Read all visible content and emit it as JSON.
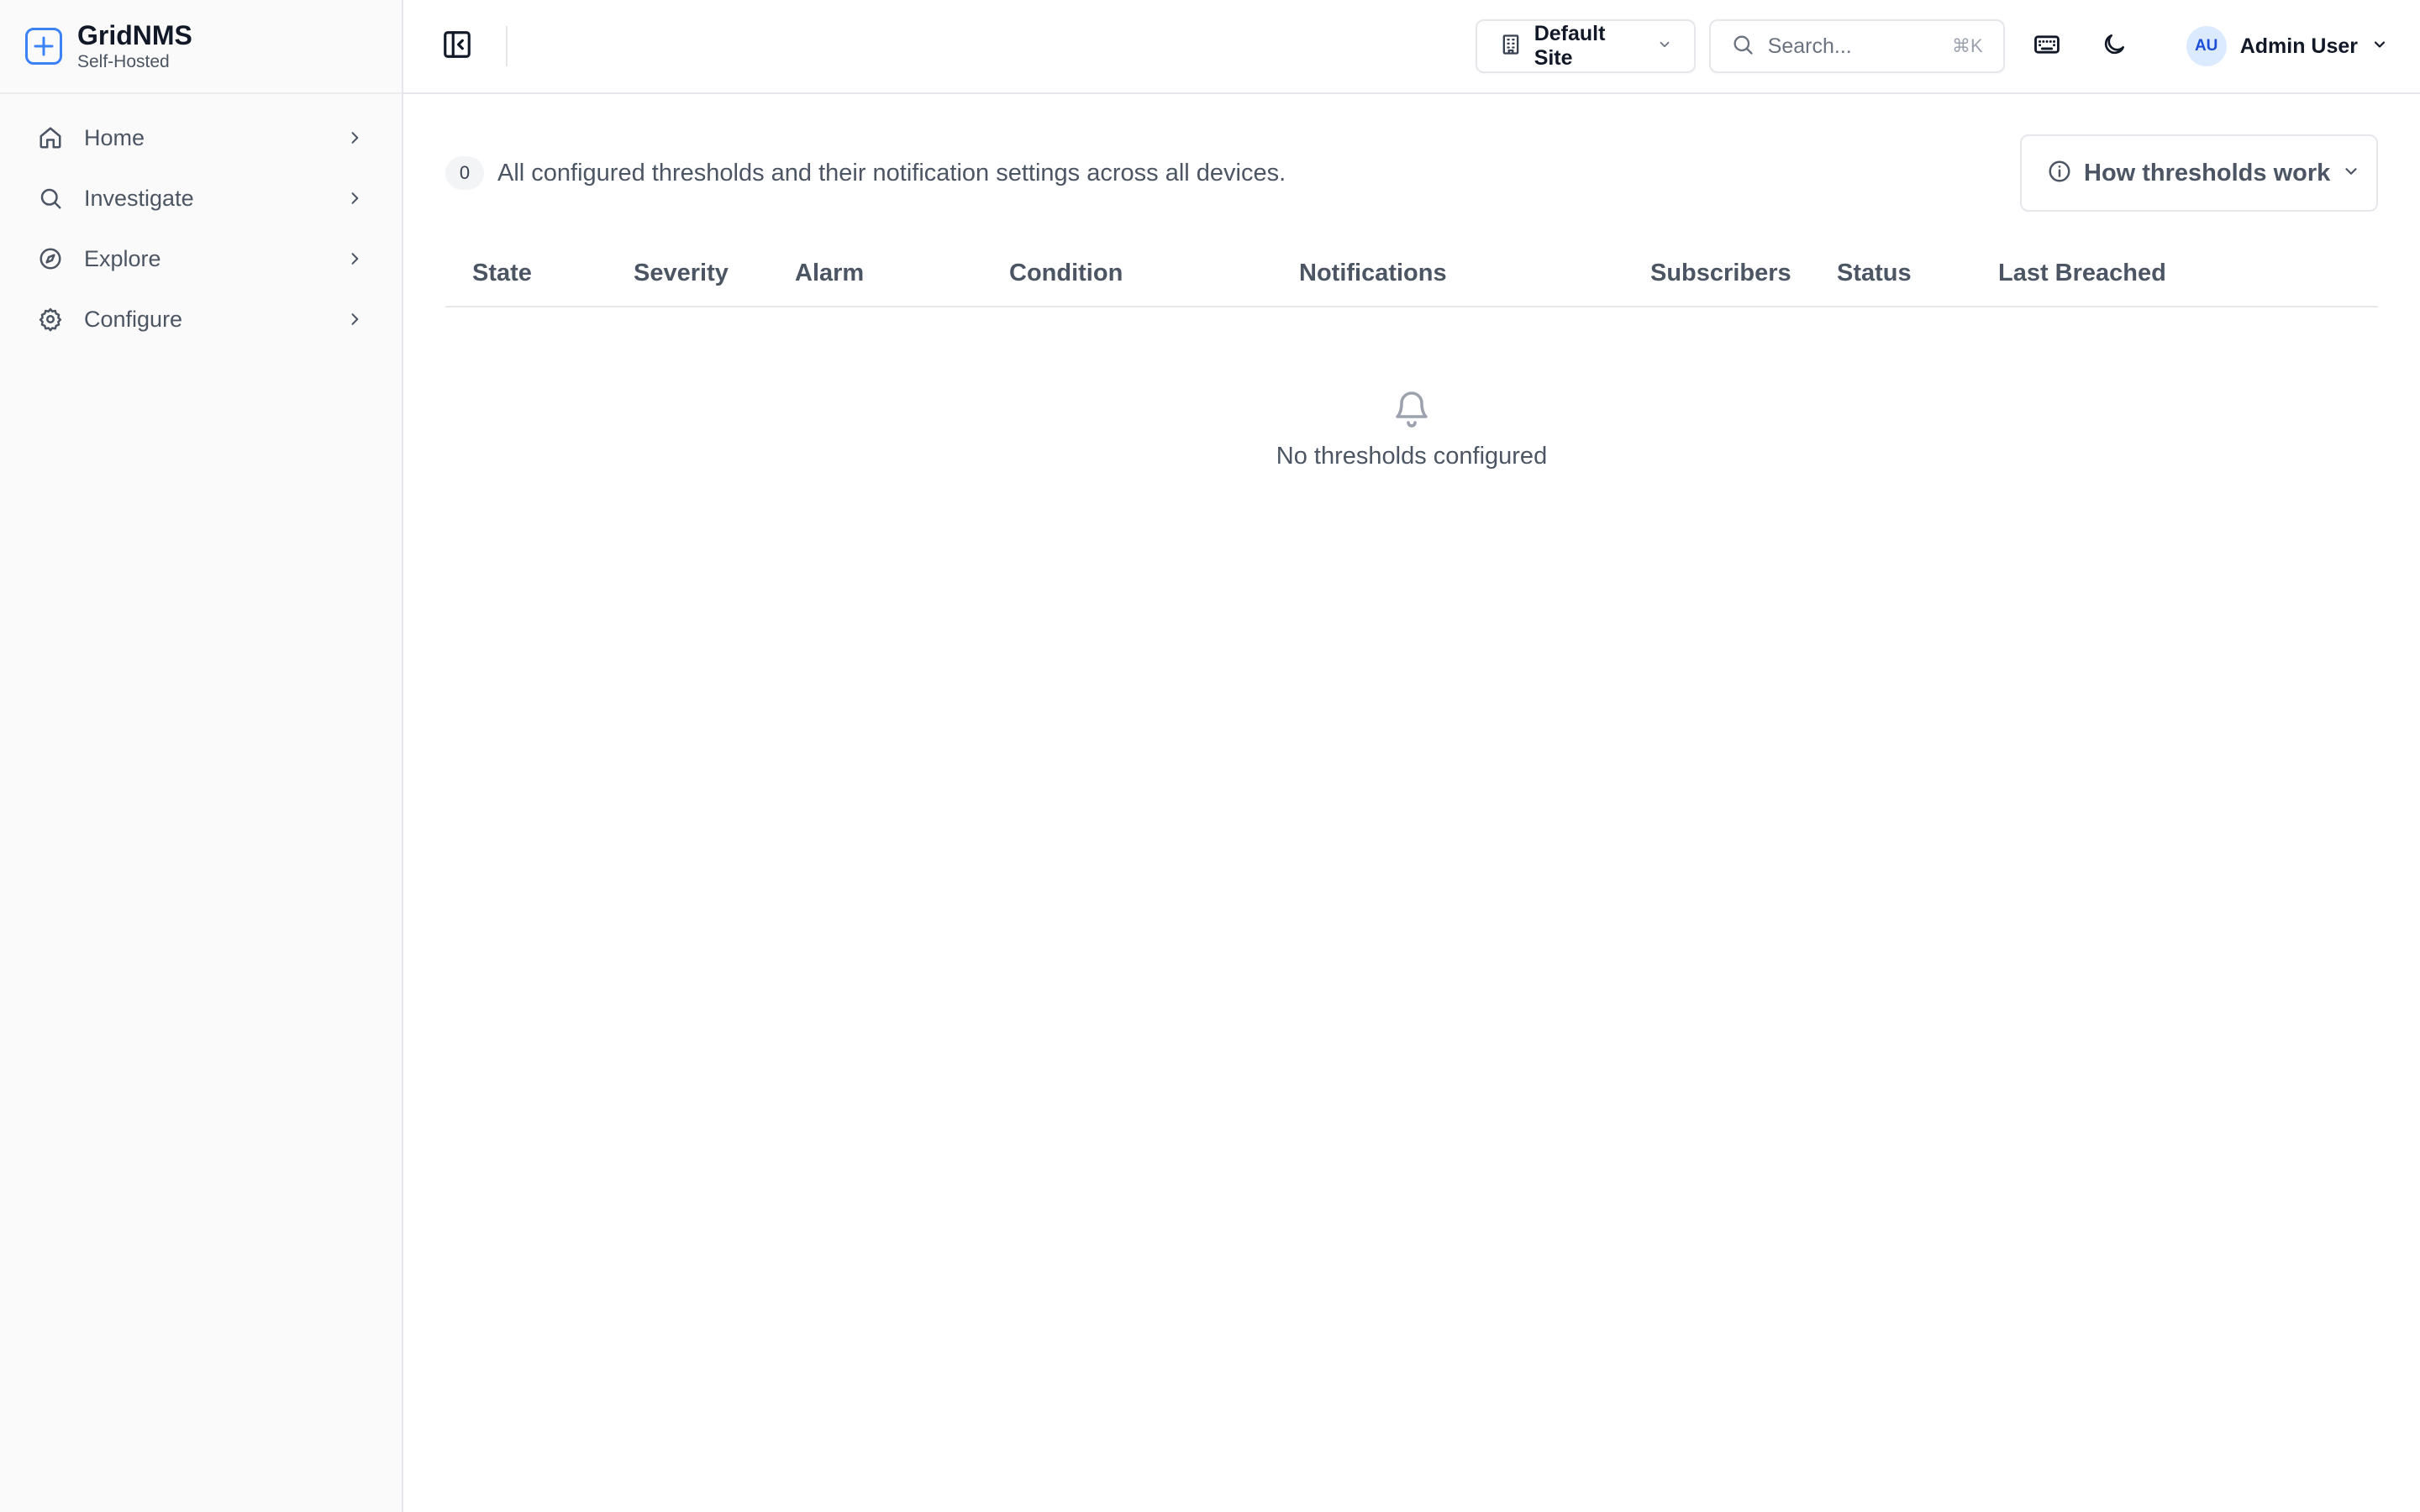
{
  "brand": {
    "title": "GridNMS",
    "subtitle": "Self-Hosted",
    "accent": "#3b82f6"
  },
  "sidebar": {
    "items": [
      {
        "label": "Home",
        "icon": "home-icon"
      },
      {
        "label": "Investigate",
        "icon": "search-icon"
      },
      {
        "label": "Explore",
        "icon": "compass-icon"
      },
      {
        "label": "Configure",
        "icon": "gear-icon"
      }
    ]
  },
  "topbar": {
    "site": "Default Site",
    "search": {
      "placeholder": "Search...",
      "shortcut": "⌘K"
    },
    "user": {
      "initials": "AU",
      "name": "Admin User"
    }
  },
  "main": {
    "count": "0",
    "summary": "All configured thresholds and their notification settings across all devices.",
    "help_button": "How thresholds work",
    "columns": [
      "State",
      "Severity",
      "Alarm",
      "Condition",
      "Notifications",
      "Subscribers",
      "Status",
      "Last Breached"
    ],
    "empty_message": "No thresholds configured"
  }
}
